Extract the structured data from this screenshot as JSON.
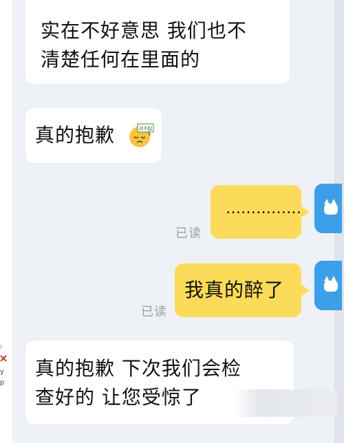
{
  "messages": [
    {
      "id": "msg1",
      "direction": "incoming",
      "text": "实在不好意思  我们也不\n清楚任何在里面的"
    },
    {
      "id": "msg2",
      "direction": "incoming",
      "text": "真的抱歉",
      "emoji": "apology-sign-emoji-icon",
      "emoji_sign_text": "对不起"
    },
    {
      "id": "msg3",
      "direction": "outgoing",
      "text": "……………",
      "status": "已读"
    },
    {
      "id": "msg4",
      "direction": "outgoing",
      "text": "我真的醉了",
      "status": "已读"
    },
    {
      "id": "msg5",
      "direction": "incoming",
      "text": "真的抱歉  下次我们会检\n查好的  让您受惊了"
    }
  ],
  "colors": {
    "chat_background": "#eef1f6",
    "incoming_bubble": "#ffffff",
    "outgoing_bubble": "#fddb5a",
    "avatar": "#3d9fe8",
    "read_status": "#9a9ea6"
  },
  "icons": {
    "avatar": "self-avatar-icon"
  }
}
